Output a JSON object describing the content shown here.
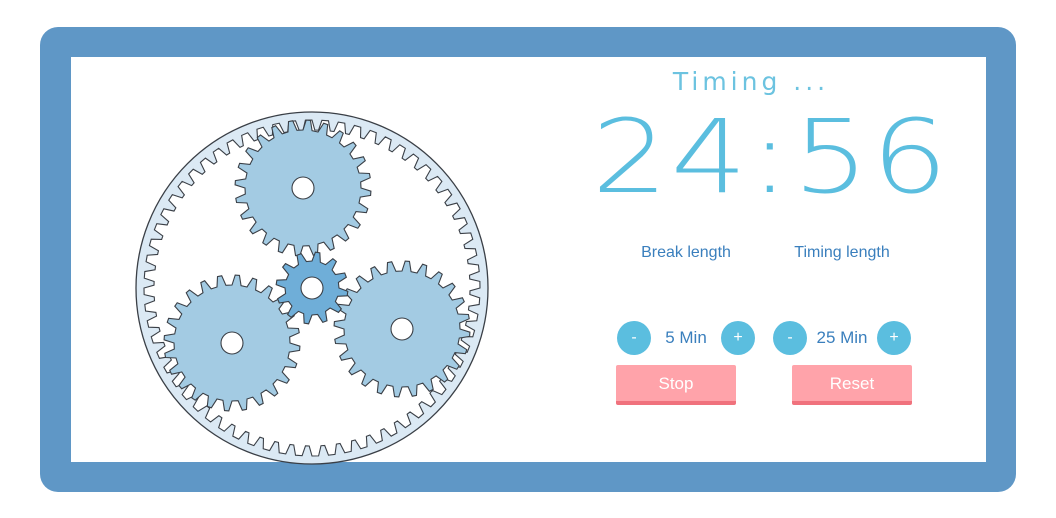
{
  "timer": {
    "status": "Timing ...",
    "time": "24:56"
  },
  "break_setting": {
    "label": "Break length",
    "value": "5 Min",
    "decrement": "-",
    "increment": "+"
  },
  "timing_setting": {
    "label": "Timing length",
    "value": "25 Min",
    "decrement": "-",
    "increment": "+"
  },
  "actions": {
    "stop": "Stop",
    "reset": "Reset"
  },
  "colors": {
    "frame": "#5f97c6",
    "accent": "#5bbedf",
    "button": "#ffa3aa",
    "gear_fill": "#a3cbe3",
    "sun_gear": "#6faed8"
  },
  "icons": {
    "gears": "planetary-gear-icon"
  }
}
